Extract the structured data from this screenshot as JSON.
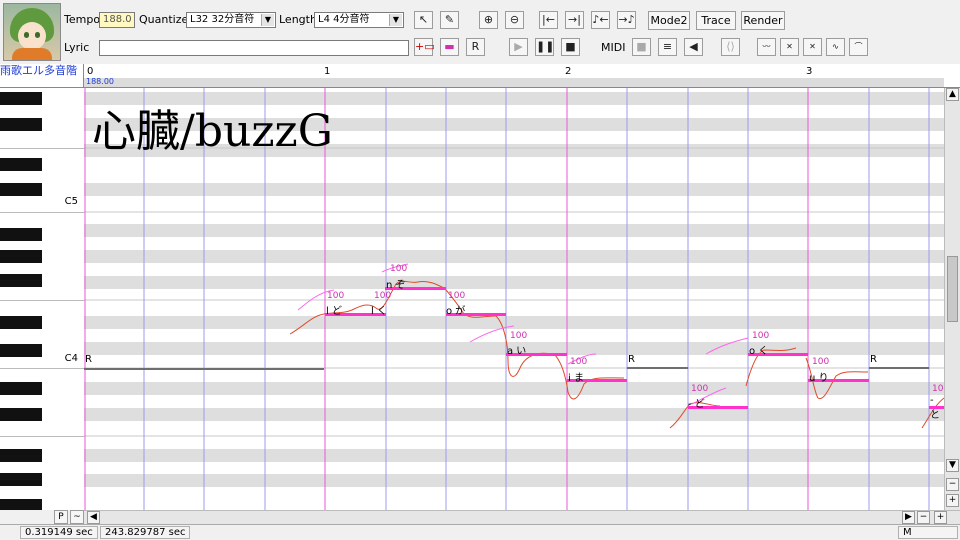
{
  "toolbar": {
    "tempo_label": "Tempo",
    "tempo_value": "188.0",
    "quantize_label": "Quantize",
    "quantize_value": "L32 32分音符",
    "length_label": "Length",
    "length_value": "L4  4分音符",
    "lyric_label": "Lyric",
    "lyric_value": "",
    "mode_button": "Mode2",
    "trace_button": "Trace",
    "render_button": "Render",
    "midi_label": "MIDI"
  },
  "ruler": {
    "singer": "雨歌エル多音階",
    "measures": [
      "0",
      "1",
      "2",
      "3"
    ],
    "tempo_marker": "188.00"
  },
  "piano": {
    "c5": "C5",
    "c4": "C4"
  },
  "title_overlay": "心臓/buzzG",
  "notes": [
    {
      "velocity": "100",
      "lyric": "l ど"
    },
    {
      "velocity": "100",
      "lyric": "l く"
    },
    {
      "velocity": "100",
      "lyric": "n ぞ"
    },
    {
      "velocity": "100",
      "lyric": "o が"
    },
    {
      "velocity": "100",
      "lyric": "a い"
    },
    {
      "velocity": "100",
      "lyric": "i ま"
    },
    {
      "velocity": "100",
      "lyric": "- ど"
    },
    {
      "velocity": "100",
      "lyric": "o く"
    },
    {
      "velocity": "100",
      "lyric": "u り"
    },
    {
      "velocity": "10",
      "lyric": "- と"
    }
  ],
  "rests": {
    "label": "R"
  },
  "lower": {
    "p_button": "P",
    "tilde_button": "~",
    "m_label": "M"
  },
  "status": {
    "time1": "0.319149 sec",
    "time2": "243.829787 sec"
  }
}
